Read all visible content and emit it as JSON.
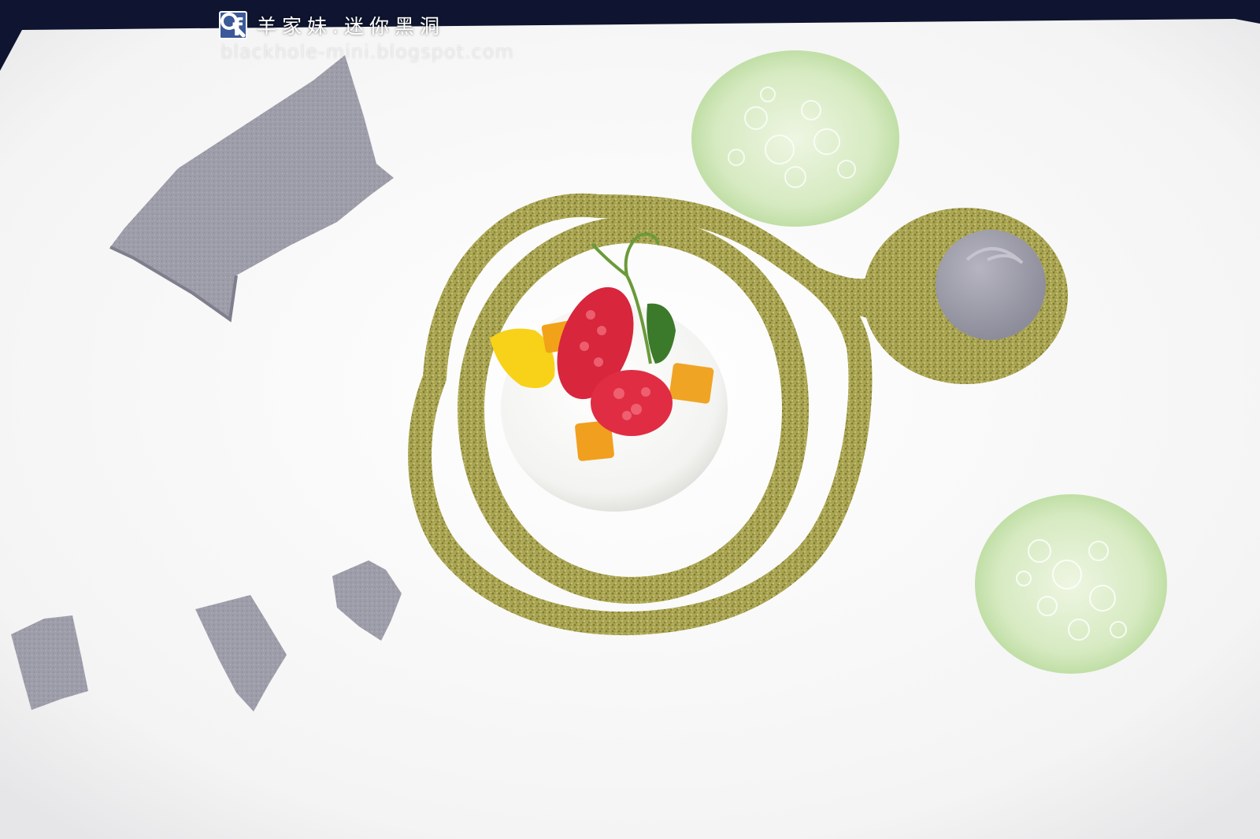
{
  "watermark": {
    "title": "羊家妹.迷你黑洞",
    "url": "blackhole-mini.blogspot.com"
  },
  "colors": {
    "background": "#0f1530",
    "plate": "#f7f7f7",
    "crumble": "#a8a452",
    "meringue": "#9c9ba6",
    "foam": "#cfe5b5",
    "raspberry": "#d7263d",
    "mango": "#f0a020",
    "facebook": "#3b5998"
  }
}
